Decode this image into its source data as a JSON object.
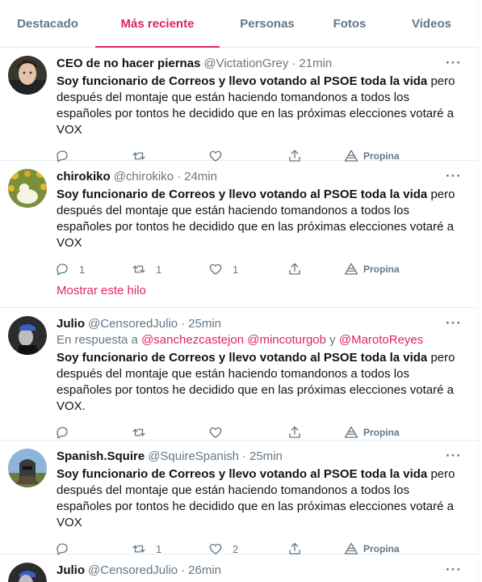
{
  "tabs": [
    {
      "label": "Destacado"
    },
    {
      "label": "Más reciente"
    },
    {
      "label": "Personas"
    },
    {
      "label": "Fotos"
    },
    {
      "label": "Videos"
    }
  ],
  "accent_color": "#e0245e",
  "show_thread_label": "Mostrar este hilo",
  "promote_label": "Propina",
  "tweets": [
    {
      "name": "CEO de no hacer piernas",
      "handle": "@VictationGrey",
      "time": "21min",
      "bold": "Soy funcionario de Correos y llevo votando al PSOE toda la vida",
      "rest": " pero después del montaje que están haciendo tomandonos a todos los españoles por tontos he decidido que en las próximas elecciones votaré a VOX",
      "replies": "",
      "retweets": "",
      "likes": ""
    },
    {
      "name": "chirokiko",
      "handle": "@chirokiko",
      "time": "24min",
      "bold": "Soy funcionario de Correos y llevo votando al PSOE toda la vida",
      "rest": " pero después del montaje que están haciendo tomandonos a todos los españoles por tontos he decidido que en las próximas elecciones votaré a VOX",
      "replies": "1",
      "retweets": "1",
      "likes": "1"
    },
    {
      "name": "Julio",
      "handle": "@CensoredJulio",
      "time": "25min",
      "reply_prefix": "En respuesta a ",
      "reply_m1": "@sanchezcastejon",
      "reply_m2": "@mincoturgob",
      "reply_and": " y ",
      "reply_m3": "@MarotoReyes",
      "bold": "Soy funcionario de Correos y llevo votando al PSOE toda la vida",
      "rest": " pero después del montaje que están haciendo tomandonos a todos los españoles por tontos he decidido que en las próximas elecciones votaré a VOX.",
      "replies": "",
      "retweets": "",
      "likes": ""
    },
    {
      "name": "Spanish.Squire",
      "handle": "@SquireSpanish",
      "time": "25min",
      "bold": "Soy funcionario de Correos y llevo votando al PSOE toda la vida",
      "rest": " pero después del montaje que están haciendo tomandonos a todos los españoles por tontos he decidido que en las próximas elecciones votaré a VOX",
      "replies": "",
      "retweets": "1",
      "likes": "2"
    },
    {
      "name": "Julio",
      "handle": "@CensoredJulio",
      "time": "26min"
    }
  ]
}
